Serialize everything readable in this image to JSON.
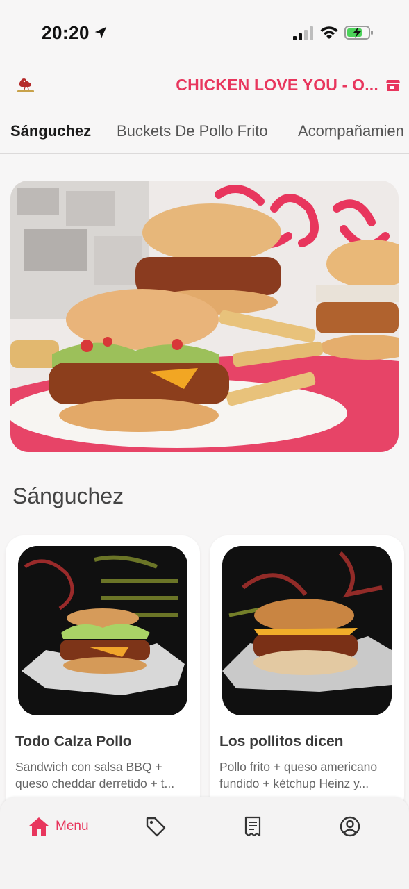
{
  "status_bar": {
    "time": "20:20"
  },
  "header": {
    "store_name": "CHICKEN LOVE YOU - O..."
  },
  "tabs": [
    {
      "label": "Sánguchez",
      "active": true
    },
    {
      "label": "Buckets De Pollo Frito",
      "active": false
    },
    {
      "label": "Acompañamien",
      "active": false
    }
  ],
  "section": {
    "title": "Sánguchez"
  },
  "products": [
    {
      "name": "Todo Calza Pollo",
      "description": "Sandwich con salsa BBQ + queso cheddar derretido + t..."
    },
    {
      "name": "Los pollitos dicen",
      "description": "Pollo frito + queso americano fundido + kétchup Heinz y..."
    }
  ],
  "bottom_nav": {
    "items": [
      {
        "icon": "home-icon",
        "label": "Menu",
        "active": true
      },
      {
        "icon": "tag-icon",
        "label": "",
        "active": false
      },
      {
        "icon": "receipt-icon",
        "label": "",
        "active": false
      },
      {
        "icon": "account-icon",
        "label": "",
        "active": false
      }
    ]
  },
  "colors": {
    "accent": "#e8365d",
    "background": "#f7f6f6"
  }
}
